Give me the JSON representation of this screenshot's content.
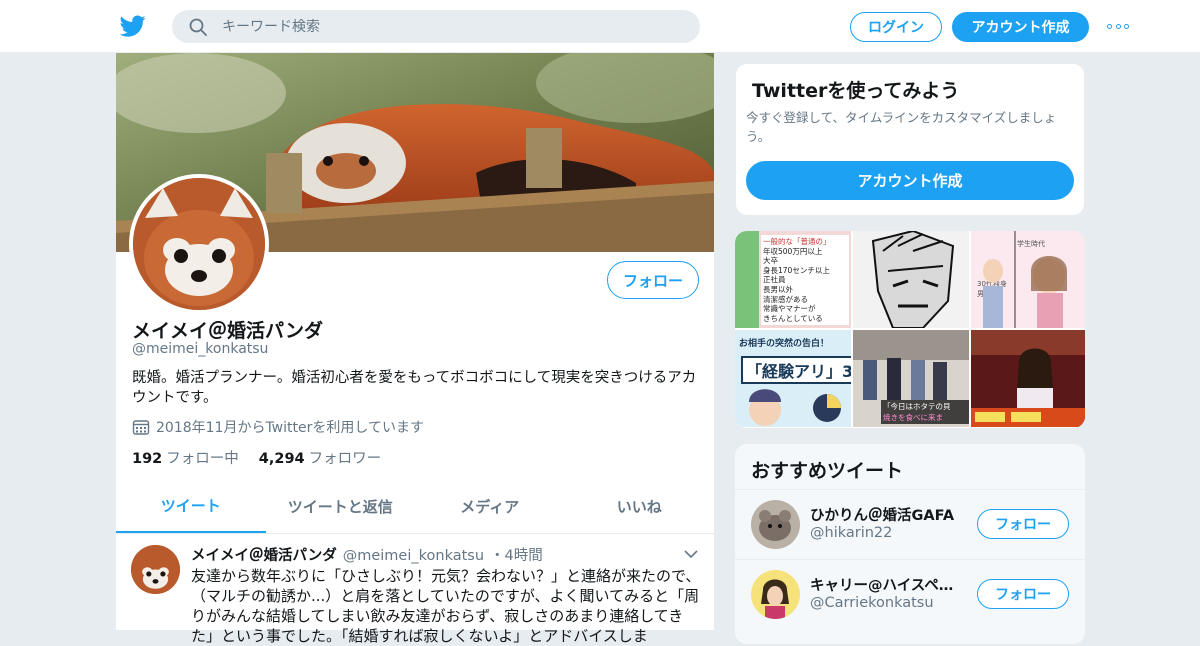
{
  "colors": {
    "accent": "#1da1f2",
    "muted": "#657786",
    "text": "#14171a",
    "bg": "#e6ecf0"
  },
  "header": {
    "logo_icon": "twitter-bird-icon",
    "search_placeholder": "キーワード検索",
    "login_label": "ログイン",
    "signup_label": "アカウント作成",
    "more_icon": "more-dots-icon"
  },
  "profile": {
    "name": "メイメイ＠婚活パンダ",
    "handle": "@meimei_konkatsu",
    "bio": "既婚。婚活プランナー。婚活初心者を愛をもってボコボコにして現実を突きつけるアカウントです。",
    "joined": "2018年11月からTwitterを利用しています",
    "follow_label": "フォロー",
    "following_count": "192",
    "following_label": "フォロー中",
    "followers_count": "4,294",
    "followers_label": "フォロワー"
  },
  "tabs": [
    "ツイート",
    "ツイートと返信",
    "メディア",
    "いいね"
  ],
  "tweet": {
    "name": "メイメイ＠婚活パンダ",
    "handle": "@meimei_konkatsu",
    "time": "・4時間",
    "text": "友達から数年ぶりに「ひさしぶり！元気？会わない？」と連絡が来たので、（マルチの勧誘か...）と肩を落としていたのですが、よく聞いてみると「周りがみんな結婚してしまい飲み友達がおらず、寂しさのあまり連絡してきた」という事でした。「結婚すれば寂しくないよ」とアドバイスしま"
  },
  "signup_card": {
    "title": "Twitterを使ってみよう",
    "desc": "今すぐ登録して、タイムラインをカスタマイズしましょう。",
    "button": "アカウント作成"
  },
  "media_grid": {
    "cell1_lines": [
      "一般的な「普通の」",
      "年収500万円以上",
      "大卒",
      "身長170センチ以上",
      "正社員",
      "長男以外",
      "清潔感がある",
      "常識やマナーが",
      "きちんとしている"
    ],
    "cell3_lines": [
      "学生時代",
      "30代独身",
      "男なし"
    ],
    "cell4_lines": [
      "お相手の突然の告白！",
      "「経験アリ」3"
    ],
    "cell5_lines": [
      "「今日はホタテの貝",
      "焼きを食べに来ま"
    ]
  },
  "recommended": {
    "title": "おすすめツイート",
    "follow_label": "フォロー",
    "users": [
      {
        "name": "ひかりん＠婚活GAFA",
        "handle": "@hikarin22"
      },
      {
        "name": "キャリー@ハイスペ婚活",
        "handle": "@Carriekonkatsu"
      }
    ]
  }
}
